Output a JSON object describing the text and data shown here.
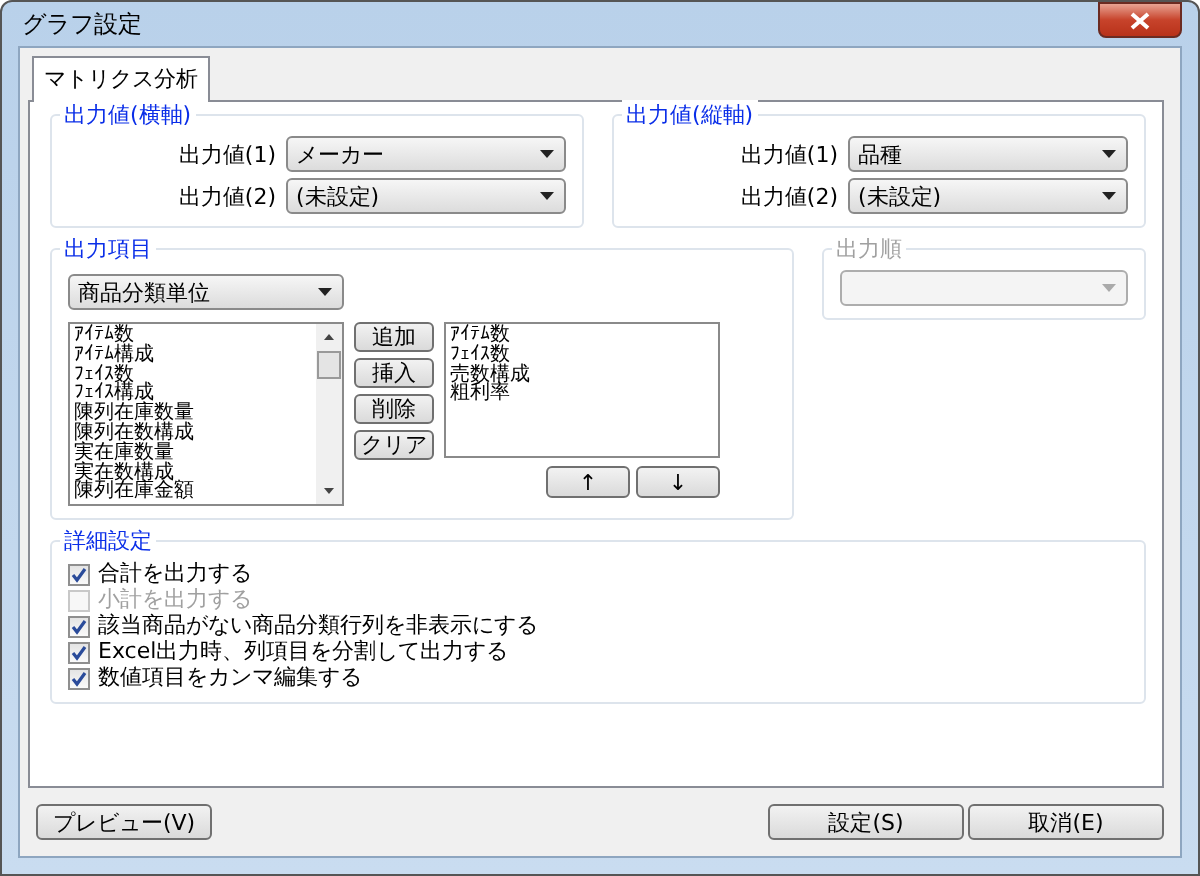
{
  "window": {
    "title": "グラフ設定"
  },
  "tabs": [
    {
      "label": "マトリクス分析",
      "selected": true
    }
  ],
  "horizontal_axis": {
    "title": "出力値(横軸)",
    "fields": [
      {
        "label": "出力値(1)",
        "value": "メーカー"
      },
      {
        "label": "出力値(2)",
        "value": "(未設定)"
      }
    ]
  },
  "vertical_axis": {
    "title": "出力値(縦軸)",
    "fields": [
      {
        "label": "出力値(1)",
        "value": "品種"
      },
      {
        "label": "出力値(2)",
        "value": "(未設定)"
      }
    ]
  },
  "output_items": {
    "title": "出力項目",
    "unit_select": "商品分類単位",
    "available": [
      "ｱｲﾃﾑ数",
      "ｱｲﾃﾑ構成",
      "ﾌｪｲｽ数",
      "ﾌｪｲｽ構成",
      "陳列在庫数量",
      "陳列在数構成",
      "実在庫数量",
      "実在数構成",
      "陳列在庫金額"
    ],
    "actions": [
      "追加",
      "挿入",
      "削除",
      "クリア"
    ],
    "chosen": [
      "ｱｲﾃﾑ数",
      "ﾌｪｲｽ数",
      "売数構成",
      "粗利率"
    ],
    "move_buttons": [
      "↑",
      "↓"
    ]
  },
  "output_order": {
    "title": "出力順",
    "disabled": true
  },
  "details": {
    "title": "詳細設定",
    "options": [
      {
        "label": "合計を出力する",
        "checked": true,
        "disabled": false
      },
      {
        "label": "小計を出力する",
        "checked": false,
        "disabled": true
      },
      {
        "label": "該当商品がない商品分類行列を非表示にする",
        "checked": true,
        "disabled": false
      },
      {
        "label": "Excel出力時、列項目を分割して出力する",
        "checked": true,
        "disabled": false
      },
      {
        "label": "数値項目をカンマ編集する",
        "checked": true,
        "disabled": false
      }
    ]
  },
  "footer": {
    "left": [
      "プレビュー(V)"
    ],
    "right": [
      "設定(S)",
      "取消(E)"
    ]
  }
}
